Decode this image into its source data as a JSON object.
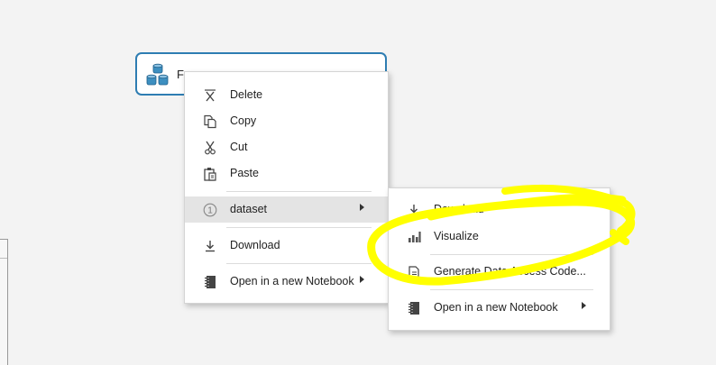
{
  "module": {
    "label": "F",
    "icon": "database-icon"
  },
  "context_menu": {
    "items": [
      {
        "label": "Delete",
        "icon": "delete-icon"
      },
      {
        "label": "Copy",
        "icon": "copy-icon"
      },
      {
        "label": "Cut",
        "icon": "cut-icon"
      },
      {
        "label": "Paste",
        "icon": "paste-icon"
      },
      {
        "label": "dataset",
        "icon": "port-1-icon",
        "submenu": true
      },
      {
        "label": "Download",
        "icon": "download-icon"
      },
      {
        "label": "Open in a new Notebook",
        "icon": "notebook-icon",
        "submenu": true
      }
    ],
    "port_number": "1"
  },
  "submenu": {
    "items": [
      {
        "label": "Download",
        "icon": "download-icon"
      },
      {
        "label": "Visualize",
        "icon": "bar-chart-icon"
      },
      {
        "label": "Generate Data Access Code...",
        "icon": "code-icon"
      },
      {
        "label": "Open in a new Notebook",
        "icon": "notebook-icon",
        "submenu": true
      }
    ]
  },
  "colors": {
    "accent": "#2e7db2",
    "highlight": "#ffff00"
  }
}
